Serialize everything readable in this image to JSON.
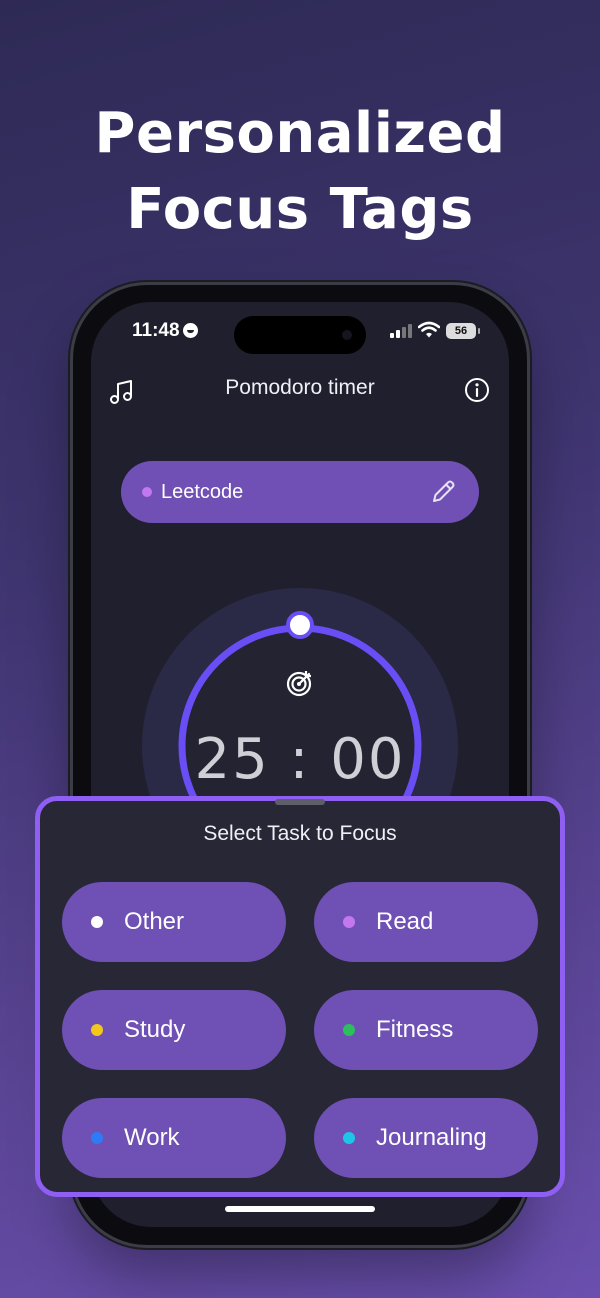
{
  "headline": {
    "line1": "Personalized",
    "line2": "Focus Tags"
  },
  "status_bar": {
    "time": "11:48",
    "battery": "56"
  },
  "header": {
    "title": "Pomodoro timer",
    "left_icon": "music-icon",
    "right_icon": "info-icon"
  },
  "current_task": {
    "label": "Leetcode",
    "dot_color": "#c378f0",
    "edit_icon": "pencil-icon"
  },
  "timer": {
    "display": "25 : 00",
    "progress": 0.0,
    "accent": "#6a4ef5",
    "icon": "target-icon"
  },
  "sheet": {
    "title": "Select Task to Focus",
    "options": [
      {
        "label": "Other",
        "color": "#ffffff"
      },
      {
        "label": "Read",
        "color": "#c378f0"
      },
      {
        "label": "Study",
        "color": "#f2c81c"
      },
      {
        "label": "Fitness",
        "color": "#2dbf5c"
      },
      {
        "label": "Work",
        "color": "#2e7bf6"
      },
      {
        "label": "Journaling",
        "color": "#1ec6e6"
      }
    ]
  },
  "colors": {
    "sheet_border": "#8f5ef2",
    "pill": "#6f50b4",
    "screen_bg": "#1f1f2d"
  }
}
